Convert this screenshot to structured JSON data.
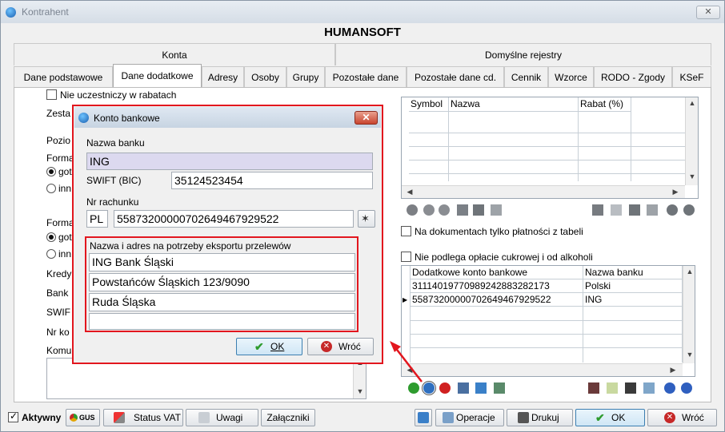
{
  "window": {
    "title": "Kontrahent",
    "close_label": "✕",
    "company": "HUMANSOFT"
  },
  "top_tabs": [
    "Konta",
    "Domyślne rejestry"
  ],
  "tabs": [
    "Dane podstawowe",
    "Dane dodatkowe",
    "Adresy",
    "Osoby",
    "Grupy",
    "Pozostałe dane",
    "Pozostałe dane cd.",
    "Cennik",
    "Wzorce",
    "RODO - Zgody",
    "KSeF"
  ],
  "left": {
    "rabat_check": "Nie uczestniczy w rabatach",
    "zesta_label": "Zesta",
    "pozio_label": "Pozio",
    "forma1_label": "Forma",
    "radio1a": "got",
    "radio1b": "inn",
    "forma2_label": "Forma",
    "radio2a": "got",
    "radio2b": "inn",
    "kredy_label": "Kredy",
    "bank_label": "Bank",
    "swif_label": "SWIF",
    "nrko_label": "Nr ko",
    "komu_label": "Komu"
  },
  "rabat_table": {
    "headers": [
      "Symbol",
      "Nazwa",
      "Rabat (%)"
    ]
  },
  "options": {
    "tylko_platnosci": "Na dokumentach tylko płatności z tabeli",
    "cukrowej": "Nie podlega opłacie cukrowej i od alkoholi"
  },
  "accounts_table": {
    "headers": [
      "Dodatkowe konto bankowe",
      "Nazwa banku"
    ],
    "rows": [
      [
        "31114019770989242883282173",
        "Polski"
      ],
      [
        "55873200000702649467929522",
        "ING"
      ]
    ],
    "current_marker": "▶"
  },
  "bottom": {
    "aktywny": "Aktywny",
    "gus": "GUS",
    "status_vat": "Status VAT",
    "uwagi": "Uwagi",
    "zalaczniki": "Załączniki",
    "operacje": "Operacje",
    "drukuj": "Drukuj",
    "ok": "OK",
    "wroc": "Wróć"
  },
  "dialog": {
    "title": "Konto bankowe",
    "close_label": "✕",
    "nazwa_banku_label": "Nazwa banku",
    "nazwa_banku_value": "ING",
    "swift_label": "SWIFT (BIC)",
    "swift_value": "35124523454",
    "nr_rachunku_label": "Nr rachunku",
    "country_code": "PL",
    "account_number": "55873200000702649467929522",
    "export_label": "Nazwa i adres na potrzeby eksportu przelewów",
    "export_lines": [
      "ING Bank Śląski",
      "Powstańców Śląskich 123/9090",
      "Ruda Śląska",
      ""
    ],
    "ok": "OK",
    "wroc": "Wróć"
  },
  "colors": {
    "highlight": "#e2161e",
    "selected_field": "#dcd9ef",
    "ok_icon": "#2e9b2e",
    "cancel_icon": "#c62828"
  }
}
